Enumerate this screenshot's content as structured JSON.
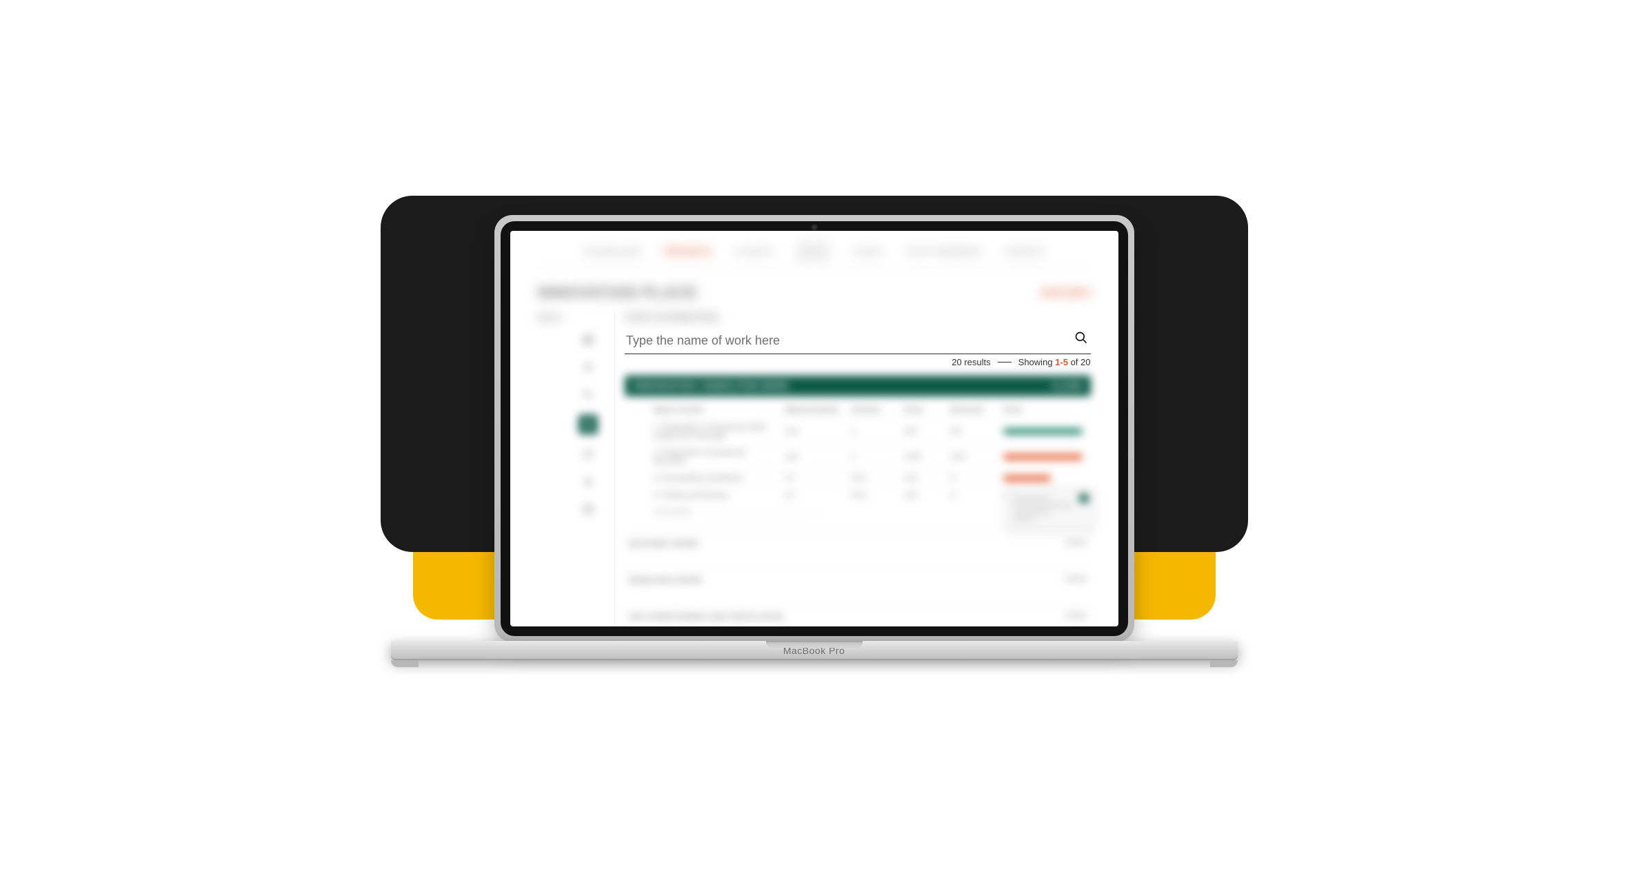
{
  "device_label": "MacBook Pro",
  "nav": {
    "items": [
      "DASHBOARD",
      "PROJECTS",
      "CLIENTS"
    ],
    "items_right": [
      "LEADS",
      "STAFF MEMBERS",
      "FINANCE"
    ],
    "active_index": 1
  },
  "page": {
    "title": "INNOVATION PLACE",
    "action": "JOHN SMITH",
    "section_label": "MENU",
    "section_title": "COST ESTIMATION"
  },
  "sidebar": {
    "items": [
      {
        "name": "dashboard-icon"
      },
      {
        "name": "list-icon"
      },
      {
        "name": "search-icon"
      },
      {
        "name": "document-icon",
        "active": true
      },
      {
        "name": "shield-icon"
      },
      {
        "name": "user-icon"
      },
      {
        "name": "calendar-icon"
      }
    ]
  },
  "search": {
    "placeholder": "Type the name of work here",
    "value": ""
  },
  "results": {
    "count_text": "20 results",
    "showing_prefix": "Showing",
    "showing_range": "1-5",
    "showing_suffix": "of 20"
  },
  "group": {
    "title": "PREPARATION / DEMOLITION WORK",
    "action": "Close"
  },
  "table": {
    "headers": [
      "Name of work",
      "Measurements",
      "Amount",
      "Price",
      "Discount",
      "Price"
    ],
    "rows": [
      {
        "name": "1. Preparation of temporary water supply and sewerage",
        "meas": "unit",
        "amount": "1",
        "price": "420",
        "discount": "0%",
        "bar": "green"
      },
      {
        "name": "2. Preparation of temporary electricity",
        "meas": "unit",
        "amount": "1",
        "price": "1230",
        "discount": "10%",
        "bar": "orange"
      },
      {
        "name": "3. Dismantling of partitions",
        "meas": "m²",
        "amount": "39.0",
        "price": "120",
        "discount": "0",
        "bar": "orange"
      },
      {
        "name": "4. Ceiling and flooring",
        "meas": "m²",
        "amount": "50.6",
        "price": "120",
        "discount": "0",
        "bar": "grey"
      }
    ],
    "comments_label": "Comments"
  },
  "popover": {
    "title": "Contractor",
    "line1": "000 – 98 – (10)",
    "line2": "cost / hrs",
    "line3": "120"
  },
  "collapsed": [
    {
      "title": "MASONRY WORK",
      "action": "Open"
    },
    {
      "title": "REMOVING WORK",
      "action": "Open"
    },
    {
      "title": "AIR CONDITIONING AND VENTILATION",
      "action": "Open"
    }
  ],
  "colors": {
    "accent_orange": "#e2572b",
    "accent_green": "#0d5a49",
    "bg_black": "#1b1b1b",
    "bg_yellow": "#f5b800"
  }
}
